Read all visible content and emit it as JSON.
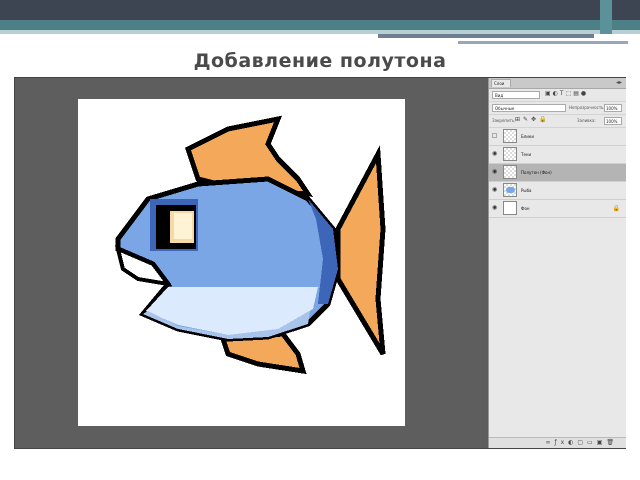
{
  "slide": {
    "title": "Добавление полутона"
  },
  "colors": {
    "band_dark": "#3d4552",
    "band_teal": "#4d7f86",
    "fish_blue": "#7aa6e6",
    "fish_dark_blue": "#3d66b8",
    "fish_light": "#dceafe",
    "fin_orange": "#f4a85a",
    "panel_bg": "#e8e8e8",
    "workspace": "#5e5e5e"
  },
  "layers_panel": {
    "tab_label": "Слои",
    "filter_label": "Вид",
    "blend_mode": "Обычные",
    "opacity_label": "Непрозрачность:",
    "opacity_value": "100%",
    "lock_label": "Закрепить:",
    "fill_label": "Заливка:",
    "fill_value": "100%",
    "layers": [
      {
        "name": "Блики",
        "visible": false,
        "selected": false,
        "thumb": "transparent"
      },
      {
        "name": "Тени",
        "visible": true,
        "selected": false,
        "thumb": "transparent"
      },
      {
        "name": "Полутон (Фон)",
        "visible": true,
        "selected": true,
        "thumb": "transparent"
      },
      {
        "name": "Рыба",
        "visible": true,
        "selected": false,
        "thumb": "fish"
      },
      {
        "name": "Фон",
        "visible": true,
        "selected": false,
        "thumb": "white",
        "locked": true
      }
    ]
  }
}
